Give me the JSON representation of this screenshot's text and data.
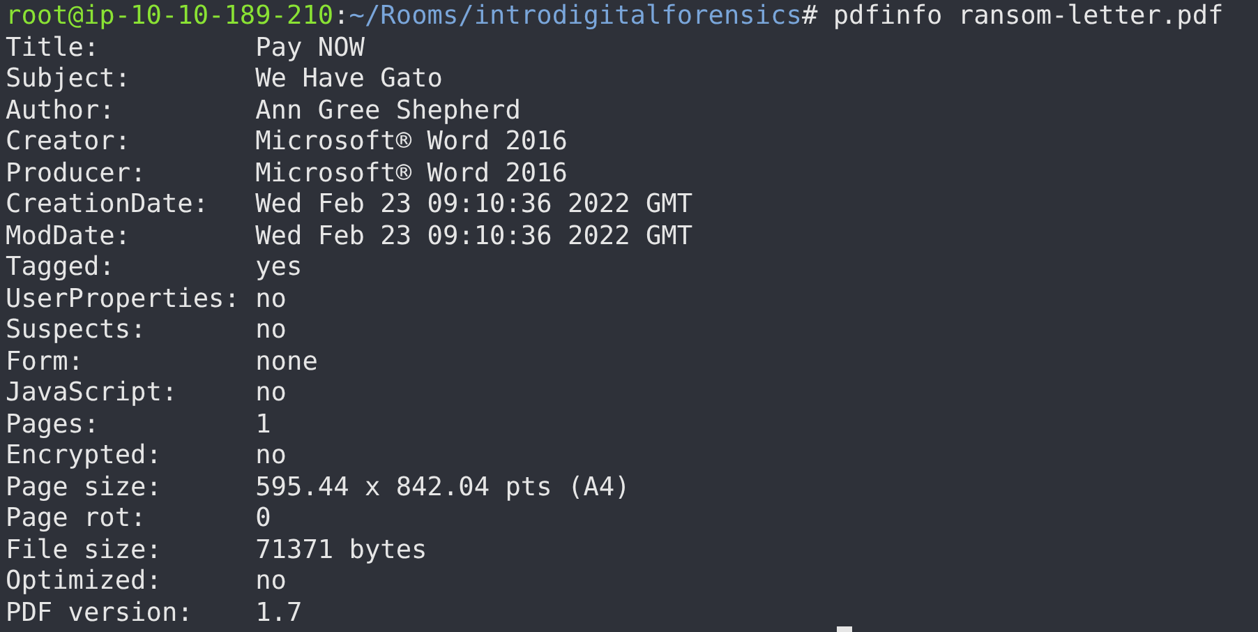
{
  "prompt": {
    "user_host": "root@ip-10-10-189-210",
    "separator": ":",
    "path": "~/Rooms/introdigitalforensics",
    "symbol": "#",
    "command": "pdfinfo ransom-letter.pdf"
  },
  "fields": [
    {
      "label": "Title:",
      "value": "Pay NOW"
    },
    {
      "label": "Subject:",
      "value": "We Have Gato"
    },
    {
      "label": "Author:",
      "value": "Ann Gree Shepherd"
    },
    {
      "label": "Creator:",
      "value": "Microsoft® Word 2016"
    },
    {
      "label": "Producer:",
      "value": "Microsoft® Word 2016"
    },
    {
      "label": "CreationDate:",
      "value": "Wed Feb 23 09:10:36 2022 GMT"
    },
    {
      "label": "ModDate:",
      "value": "Wed Feb 23 09:10:36 2022 GMT"
    },
    {
      "label": "Tagged:",
      "value": "yes"
    },
    {
      "label": "UserProperties:",
      "value": "no"
    },
    {
      "label": "Suspects:",
      "value": "no"
    },
    {
      "label": "Form:",
      "value": "none"
    },
    {
      "label": "JavaScript:",
      "value": "no"
    },
    {
      "label": "Pages:",
      "value": "1"
    },
    {
      "label": "Encrypted:",
      "value": "no"
    },
    {
      "label": "Page size:",
      "value": "595.44 x 842.04 pts (A4)"
    },
    {
      "label": "Page rot:",
      "value": "0"
    },
    {
      "label": "File size:",
      "value": "71371 bytes"
    },
    {
      "label": "Optimized:",
      "value": "no"
    },
    {
      "label": "PDF version:",
      "value": "1.7"
    }
  ]
}
